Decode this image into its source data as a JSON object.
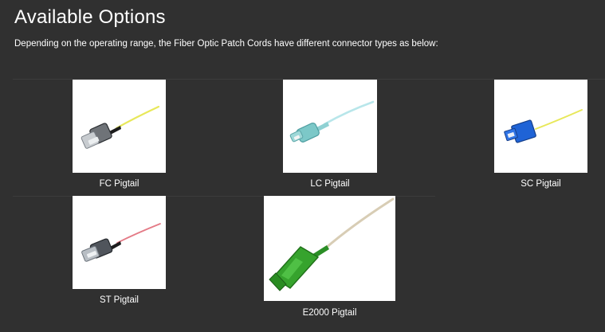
{
  "page": {
    "title": "Available Options",
    "intro": "Depending on the operating range, the Fiber Optic Patch Cords have different connector types as below:"
  },
  "products": [
    {
      "caption": "FC Pigtail",
      "image_alt": "FC Pigtail connector with yellow fiber"
    },
    {
      "caption": "LC Pigtail",
      "image_alt": "LC Pigtail connector with aqua fiber"
    },
    {
      "caption": "SC Pigtail",
      "image_alt": "SC Pigtail connector with yellow fiber"
    },
    {
      "caption": "ST Pigtail",
      "image_alt": "ST Pigtail connector with red fiber"
    },
    {
      "caption": "E2000 Pigtail",
      "image_alt": "E2000 Pigtail connector with beige fiber"
    }
  ],
  "colors": {
    "background": "#303030",
    "text": "#ffffff",
    "divider": "#3c3c3c",
    "fc_fiber": "#e8e85a",
    "lc_connector": "#7cc8c8",
    "sc_connector": "#1f63d6",
    "st_fiber": "#e47a86",
    "e2000_connector": "#36a32d"
  }
}
